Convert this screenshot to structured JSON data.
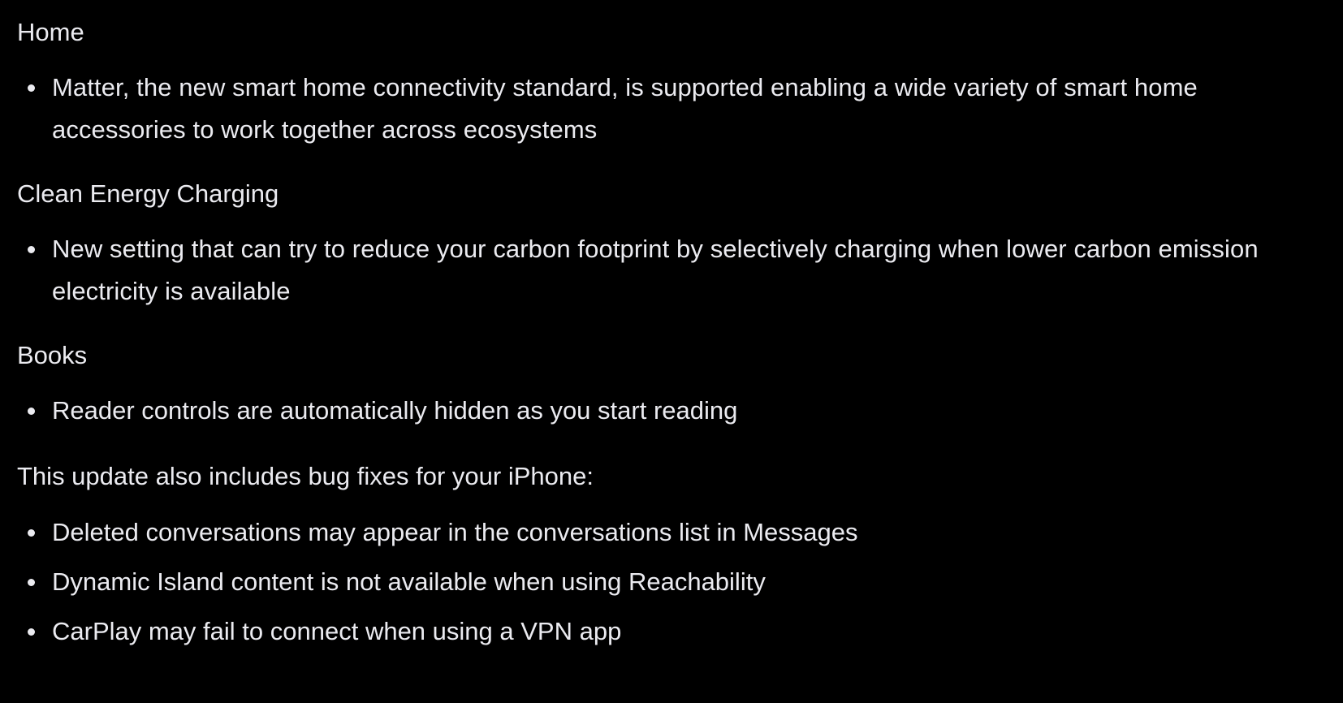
{
  "sections": [
    {
      "title": "Home",
      "items": [
        "Matter, the new smart home connectivity standard, is supported enabling a wide variety of smart home accessories to work together across ecosystems"
      ]
    },
    {
      "title": "Clean Energy Charging",
      "items": [
        "New setting that can try to reduce your carbon footprint by selectively charging when lower carbon emission electricity is available"
      ]
    },
    {
      "title": "Books",
      "items": [
        "Reader controls are automatically hidden as you start reading"
      ]
    },
    {
      "title": "This update also includes bug fixes for your iPhone:",
      "items": [
        "Deleted conversations may appear in the conversations list in Messages",
        "Dynamic Island content is not available when using Reachability",
        "CarPlay may fail to connect when using a VPN app"
      ]
    }
  ],
  "colors": {
    "background": "#000000",
    "text": "#ebebf0"
  }
}
